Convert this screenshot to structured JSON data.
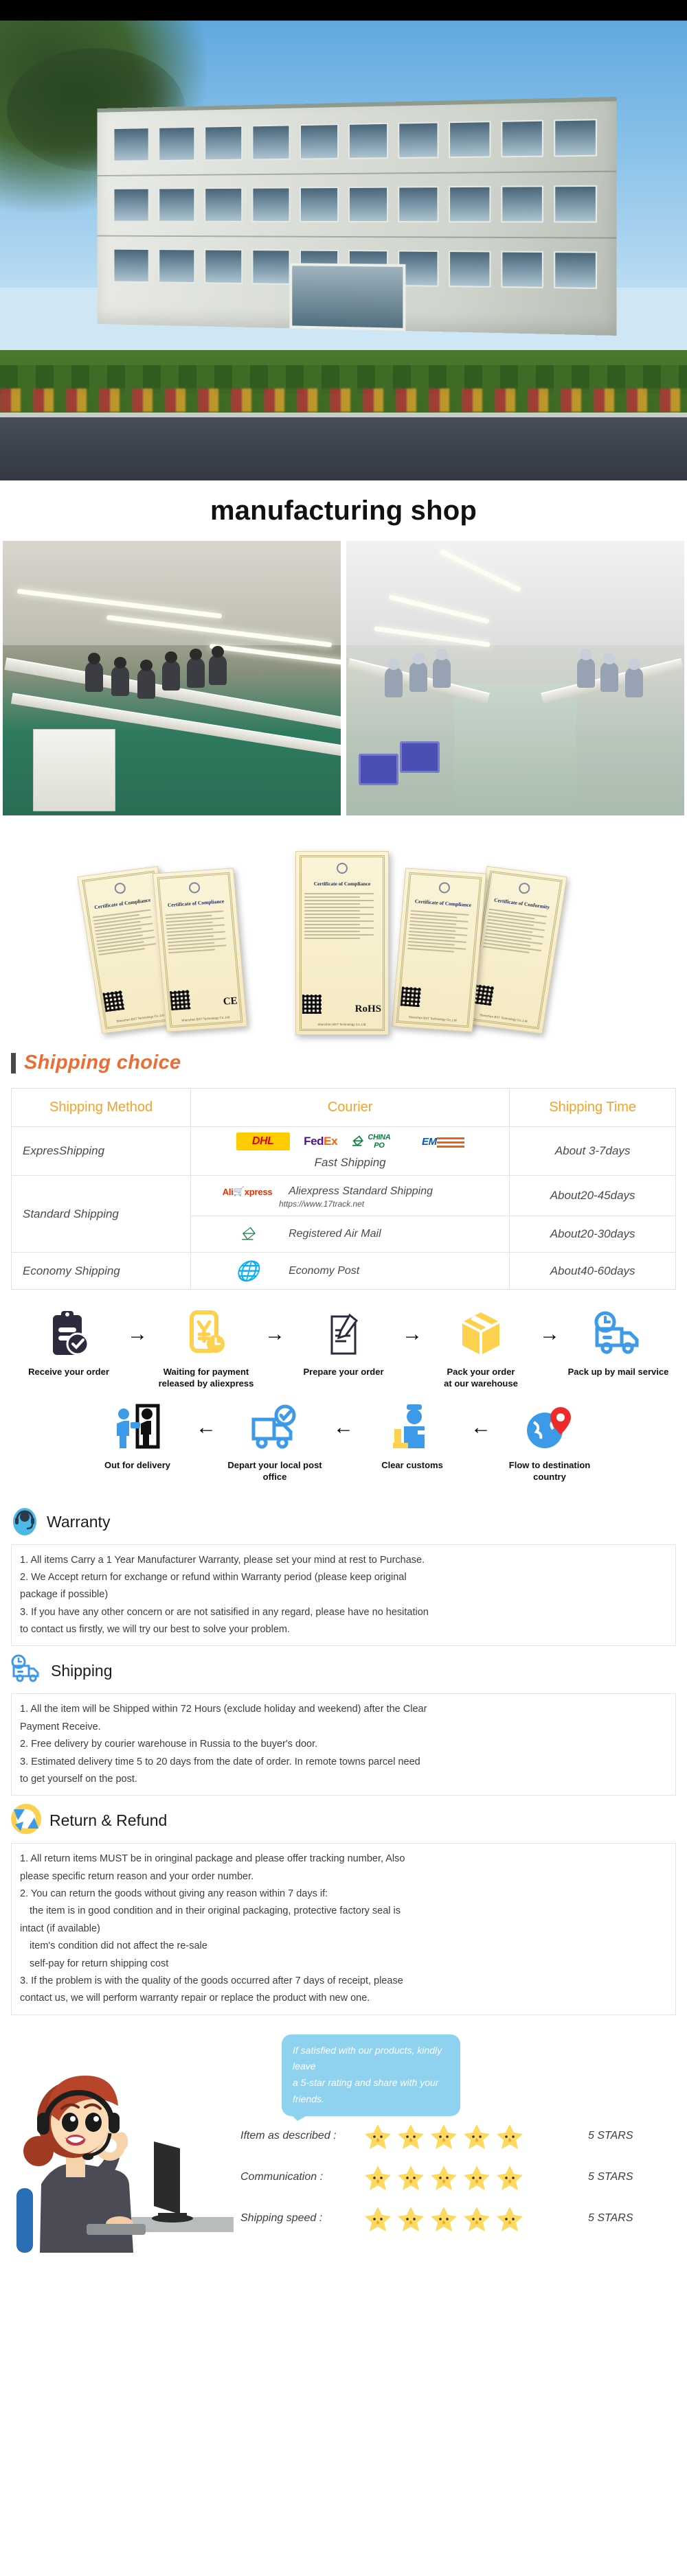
{
  "hero": {
    "alt": "factory-building-exterior"
  },
  "shop_section": {
    "title": "manufacturing shop",
    "photos": [
      {
        "alt": "assembly-line-workshop-photo-1"
      },
      {
        "alt": "assembly-line-workshop-photo-2"
      }
    ]
  },
  "certificates": {
    "items": [
      {
        "title": "Certificate of Compliance",
        "mark": ""
      },
      {
        "title": "Certificate of Compliance",
        "mark": "CE"
      },
      {
        "title": "Certificate of Compliance",
        "mark": "RoHS"
      },
      {
        "title": "Certificate of Compliance",
        "mark": ""
      },
      {
        "title": "Certificate of Conformity",
        "mark": ""
      }
    ],
    "footer_note": "Shenzhen BST Technology Co.,Ltd."
  },
  "shipping_choice": {
    "heading": "Shipping choice",
    "accent_color": "#ec6c35",
    "bar_color": "#4a4a4a",
    "table": {
      "headers": [
        "Shipping Method",
        "Courier",
        "Shipping Time"
      ],
      "header_color": "#f5a12a",
      "rows": [
        {
          "method": "ExpresShipping",
          "couriers": [
            {
              "logos": [
                "DHL",
                "FedEx",
                "CHINA POST",
                "EMS"
              ],
              "name": "Fast Shipping",
              "track_url": ""
            }
          ],
          "time": "About 3-7days"
        },
        {
          "method": "Standard Shipping",
          "couriers": [
            {
              "logo": "AliExpress",
              "name": "Aliexpress Standard Shipping",
              "track_url": "https://www.17track.net",
              "time": "About20-45days"
            },
            {
              "logo": "China Post",
              "name": "Registered Air Mail",
              "track_url": "",
              "time": "About20-30days"
            }
          ]
        },
        {
          "method": "Economy Shipping",
          "couriers": [
            {
              "logo": "UN",
              "name": "Economy Post",
              "track_url": ""
            }
          ],
          "time": "About40-60days"
        }
      ]
    }
  },
  "order_flow": {
    "row1": [
      {
        "icon": "clipboard-check-icon",
        "label": "Receive your order"
      },
      {
        "icon": "payment-yen-clock-icon",
        "label": "Waiting for payment\nreleased by aliexpress"
      },
      {
        "icon": "document-pen-icon",
        "label": "Prepare your order"
      },
      {
        "icon": "package-box-icon",
        "label": "Pack your order\nat our warehouse"
      },
      {
        "icon": "delivery-truck-clock-icon",
        "label": "Pack up by mail service"
      }
    ],
    "row2": [
      {
        "icon": "handover-delivery-icon",
        "label": "Out for delivery"
      },
      {
        "icon": "post-van-check-icon",
        "label": "Depart your local post office"
      },
      {
        "icon": "customs-officer-icon",
        "label": "Clear customs"
      },
      {
        "icon": "globe-pin-icon",
        "label": "Flow to destination country"
      }
    ],
    "arrow_glyph": "→",
    "arrow_glyph_rev": "←"
  },
  "policies": [
    {
      "icon": "headset-support-icon",
      "title": "Warranty",
      "lines": [
        {
          "text": "1. All items Carry a 1 Year Manufacturer Warranty, please set your mind at rest to Purchase.",
          "indent": false
        },
        {
          "text": "2. We Accept return for exchange or refund within Warranty period (please keep original",
          "indent": false
        },
        {
          "text": "package if possible)",
          "indent": false
        },
        {
          "text": "3. If you have any other concern or are not satisified in any regard, please have no hesitation",
          "indent": false
        },
        {
          "text": "to contact us firstly, we will try our best to solve your problem.",
          "indent": false
        }
      ]
    },
    {
      "icon": "truck-clock-icon",
      "title": "Shipping",
      "lines": [
        {
          "text": "1. All the item will be Shipped within 72 Hours (exclude holiday and weekend) after the Clear",
          "indent": false
        },
        {
          "text": "Payment Receive.",
          "indent": false
        },
        {
          "text": "2. Free delivery by courier warehouse in Russia to the buyer's door.",
          "indent": false
        },
        {
          "text": "3. Estimated delivery time 5 to 20 days from the date of order. In remote towns parcel need",
          "indent": false
        },
        {
          "text": "to get yourself on the post.",
          "indent": false
        }
      ]
    },
    {
      "icon": "return-refund-arrows-icon",
      "title": "Return & Refund",
      "lines": [
        {
          "text": "1. All return items MUST be in oringinal package and please offer tracking number, Also",
          "indent": false
        },
        {
          "text": "please specific return reason and your order number.",
          "indent": false
        },
        {
          "text": "2. You can return the goods without giving any reason within 7 days if:",
          "indent": false
        },
        {
          "text": "the item is in good condition and in their original packaging, protective factory seal is",
          "indent": true
        },
        {
          "text": "intact (if available)",
          "indent": false
        },
        {
          "text": "item's condition did not affect the re-sale",
          "indent": true
        },
        {
          "text": "self-pay for return shipping cost",
          "indent": true
        },
        {
          "text": "3. If the problem is with the quality of the goods occurred after 7 days of receipt, please",
          "indent": false
        },
        {
          "text": "contact us, we will perform warranty repair or replace the product with new one.",
          "indent": false
        }
      ]
    }
  ],
  "feedback": {
    "agent_alt": "customer-service-agent-illustration",
    "bubble_lines": [
      "If satisfied with our products, kindly leave",
      "a 5-star rating and share with your friends."
    ],
    "bubble_color": "#8fd2f0",
    "star_color": "#ffd95e",
    "ratings": [
      {
        "label": "Iftem as described :",
        "stars": 5,
        "value": "5 STARS"
      },
      {
        "label": "Communication :",
        "stars": 5,
        "value": "5 STARS"
      },
      {
        "label": "Shipping speed :",
        "stars": 5,
        "value": "5 STARS"
      }
    ]
  }
}
